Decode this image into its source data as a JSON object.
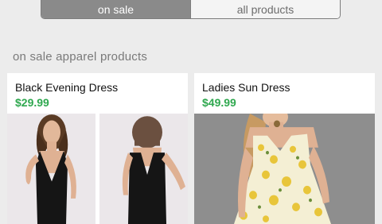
{
  "tabs": {
    "on_sale": "on sale",
    "all_products": "all products"
  },
  "section": {
    "title": "on sale apparel products"
  },
  "products": [
    {
      "name": "Black Evening Dress",
      "price": "$29.99"
    },
    {
      "name": "Ladies Sun Dress",
      "price": "$49.99"
    }
  ],
  "colors": {
    "price": "#2fa84f",
    "active_tab": "#8a8a8a",
    "background": "#ececec"
  }
}
